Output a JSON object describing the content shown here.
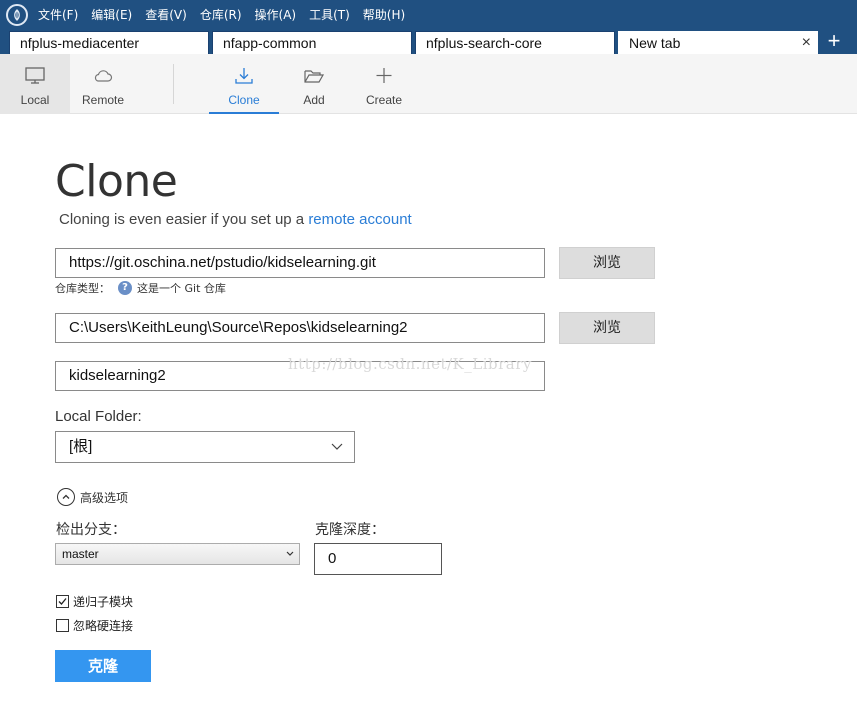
{
  "menu": {
    "items": [
      "文件(F)",
      "编辑(E)",
      "查看(V)",
      "仓库(R)",
      "操作(A)",
      "工具(T)",
      "帮助(H)"
    ]
  },
  "tabs": [
    {
      "label": "nfplus-mediacenter"
    },
    {
      "label": "nfapp-common"
    },
    {
      "label": "nfplus-search-core"
    },
    {
      "label": "New tab",
      "close": "×"
    }
  ],
  "add_tab": "+",
  "toolbar": {
    "local": {
      "label": "Local",
      "icon": "monitor-icon"
    },
    "remote": {
      "label": "Remote",
      "icon": "cloud-icon"
    },
    "clone": {
      "label": "Clone",
      "icon": "download-icon"
    },
    "add": {
      "label": "Add",
      "icon": "folder-open-icon"
    },
    "create": {
      "label": "Create",
      "icon": "plus-icon"
    }
  },
  "page": {
    "title": "Clone",
    "subtitle_text": "Cloning is even easier if you set up a ",
    "subtitle_link": "remote account"
  },
  "form": {
    "source_url": "https://git.oschina.net/pstudio/kidselearning.git",
    "browse_label": "浏览",
    "repo_type_label": "仓库类型：",
    "repo_type_value": "这是一个 Git 仓库",
    "dest_path": "C:\\Users\\KeithLeung\\Source\\Repos\\kidselearning2",
    "name": "kidselearning2",
    "local_folder_label": "Local Folder:",
    "local_folder_value": "[根]",
    "advanced_label": "高级选项",
    "branch_label": "检出分支：",
    "branch_value": "master",
    "depth_label": "克隆深度：",
    "depth_value": "0",
    "recurse_label": "递归子模块",
    "recurse_checked": true,
    "ignore_hardlinks_label": "忽略硬连接",
    "ignore_hardlinks_checked": false,
    "clone_button": "克隆"
  },
  "watermark": "http://blog.csdn.net/K_Library",
  "colors": {
    "titlebar": "#205081",
    "accent": "#2a7dd6",
    "primary_button": "#3496f0"
  }
}
